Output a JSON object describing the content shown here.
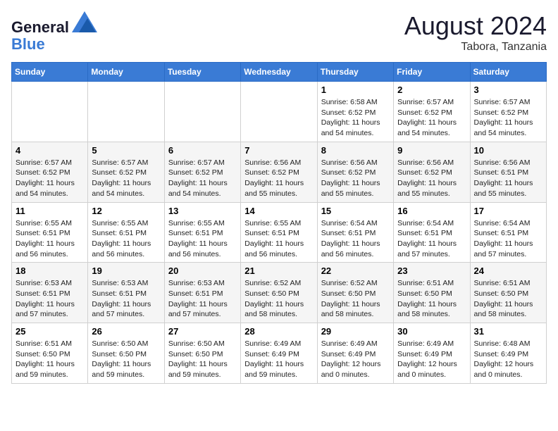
{
  "header": {
    "logo_line1": "General",
    "logo_line2": "Blue",
    "month_year": "August 2024",
    "location": "Tabora, Tanzania"
  },
  "weekdays": [
    "Sunday",
    "Monday",
    "Tuesday",
    "Wednesday",
    "Thursday",
    "Friday",
    "Saturday"
  ],
  "weeks": [
    [
      {
        "day": "",
        "sunrise": "",
        "sunset": "",
        "daylight": ""
      },
      {
        "day": "",
        "sunrise": "",
        "sunset": "",
        "daylight": ""
      },
      {
        "day": "",
        "sunrise": "",
        "sunset": "",
        "daylight": ""
      },
      {
        "day": "",
        "sunrise": "",
        "sunset": "",
        "daylight": ""
      },
      {
        "day": "1",
        "sunrise": "Sunrise: 6:58 AM",
        "sunset": "Sunset: 6:52 PM",
        "daylight": "Daylight: 11 hours and 54 minutes."
      },
      {
        "day": "2",
        "sunrise": "Sunrise: 6:57 AM",
        "sunset": "Sunset: 6:52 PM",
        "daylight": "Daylight: 11 hours and 54 minutes."
      },
      {
        "day": "3",
        "sunrise": "Sunrise: 6:57 AM",
        "sunset": "Sunset: 6:52 PM",
        "daylight": "Daylight: 11 hours and 54 minutes."
      }
    ],
    [
      {
        "day": "4",
        "sunrise": "Sunrise: 6:57 AM",
        "sunset": "Sunset: 6:52 PM",
        "daylight": "Daylight: 11 hours and 54 minutes."
      },
      {
        "day": "5",
        "sunrise": "Sunrise: 6:57 AM",
        "sunset": "Sunset: 6:52 PM",
        "daylight": "Daylight: 11 hours and 54 minutes."
      },
      {
        "day": "6",
        "sunrise": "Sunrise: 6:57 AM",
        "sunset": "Sunset: 6:52 PM",
        "daylight": "Daylight: 11 hours and 54 minutes."
      },
      {
        "day": "7",
        "sunrise": "Sunrise: 6:56 AM",
        "sunset": "Sunset: 6:52 PM",
        "daylight": "Daylight: 11 hours and 55 minutes."
      },
      {
        "day": "8",
        "sunrise": "Sunrise: 6:56 AM",
        "sunset": "Sunset: 6:52 PM",
        "daylight": "Daylight: 11 hours and 55 minutes."
      },
      {
        "day": "9",
        "sunrise": "Sunrise: 6:56 AM",
        "sunset": "Sunset: 6:52 PM",
        "daylight": "Daylight: 11 hours and 55 minutes."
      },
      {
        "day": "10",
        "sunrise": "Sunrise: 6:56 AM",
        "sunset": "Sunset: 6:51 PM",
        "daylight": "Daylight: 11 hours and 55 minutes."
      }
    ],
    [
      {
        "day": "11",
        "sunrise": "Sunrise: 6:55 AM",
        "sunset": "Sunset: 6:51 PM",
        "daylight": "Daylight: 11 hours and 56 minutes."
      },
      {
        "day": "12",
        "sunrise": "Sunrise: 6:55 AM",
        "sunset": "Sunset: 6:51 PM",
        "daylight": "Daylight: 11 hours and 56 minutes."
      },
      {
        "day": "13",
        "sunrise": "Sunrise: 6:55 AM",
        "sunset": "Sunset: 6:51 PM",
        "daylight": "Daylight: 11 hours and 56 minutes."
      },
      {
        "day": "14",
        "sunrise": "Sunrise: 6:55 AM",
        "sunset": "Sunset: 6:51 PM",
        "daylight": "Daylight: 11 hours and 56 minutes."
      },
      {
        "day": "15",
        "sunrise": "Sunrise: 6:54 AM",
        "sunset": "Sunset: 6:51 PM",
        "daylight": "Daylight: 11 hours and 56 minutes."
      },
      {
        "day": "16",
        "sunrise": "Sunrise: 6:54 AM",
        "sunset": "Sunset: 6:51 PM",
        "daylight": "Daylight: 11 hours and 57 minutes."
      },
      {
        "day": "17",
        "sunrise": "Sunrise: 6:54 AM",
        "sunset": "Sunset: 6:51 PM",
        "daylight": "Daylight: 11 hours and 57 minutes."
      }
    ],
    [
      {
        "day": "18",
        "sunrise": "Sunrise: 6:53 AM",
        "sunset": "Sunset: 6:51 PM",
        "daylight": "Daylight: 11 hours and 57 minutes."
      },
      {
        "day": "19",
        "sunrise": "Sunrise: 6:53 AM",
        "sunset": "Sunset: 6:51 PM",
        "daylight": "Daylight: 11 hours and 57 minutes."
      },
      {
        "day": "20",
        "sunrise": "Sunrise: 6:53 AM",
        "sunset": "Sunset: 6:51 PM",
        "daylight": "Daylight: 11 hours and 57 minutes."
      },
      {
        "day": "21",
        "sunrise": "Sunrise: 6:52 AM",
        "sunset": "Sunset: 6:50 PM",
        "daylight": "Daylight: 11 hours and 58 minutes."
      },
      {
        "day": "22",
        "sunrise": "Sunrise: 6:52 AM",
        "sunset": "Sunset: 6:50 PM",
        "daylight": "Daylight: 11 hours and 58 minutes."
      },
      {
        "day": "23",
        "sunrise": "Sunrise: 6:51 AM",
        "sunset": "Sunset: 6:50 PM",
        "daylight": "Daylight: 11 hours and 58 minutes."
      },
      {
        "day": "24",
        "sunrise": "Sunrise: 6:51 AM",
        "sunset": "Sunset: 6:50 PM",
        "daylight": "Daylight: 11 hours and 58 minutes."
      }
    ],
    [
      {
        "day": "25",
        "sunrise": "Sunrise: 6:51 AM",
        "sunset": "Sunset: 6:50 PM",
        "daylight": "Daylight: 11 hours and 59 minutes."
      },
      {
        "day": "26",
        "sunrise": "Sunrise: 6:50 AM",
        "sunset": "Sunset: 6:50 PM",
        "daylight": "Daylight: 11 hours and 59 minutes."
      },
      {
        "day": "27",
        "sunrise": "Sunrise: 6:50 AM",
        "sunset": "Sunset: 6:50 PM",
        "daylight": "Daylight: 11 hours and 59 minutes."
      },
      {
        "day": "28",
        "sunrise": "Sunrise: 6:49 AM",
        "sunset": "Sunset: 6:49 PM",
        "daylight": "Daylight: 11 hours and 59 minutes."
      },
      {
        "day": "29",
        "sunrise": "Sunrise: 6:49 AM",
        "sunset": "Sunset: 6:49 PM",
        "daylight": "Daylight: 12 hours and 0 minutes."
      },
      {
        "day": "30",
        "sunrise": "Sunrise: 6:49 AM",
        "sunset": "Sunset: 6:49 PM",
        "daylight": "Daylight: 12 hours and 0 minutes."
      },
      {
        "day": "31",
        "sunrise": "Sunrise: 6:48 AM",
        "sunset": "Sunset: 6:49 PM",
        "daylight": "Daylight: 12 hours and 0 minutes."
      }
    ]
  ]
}
